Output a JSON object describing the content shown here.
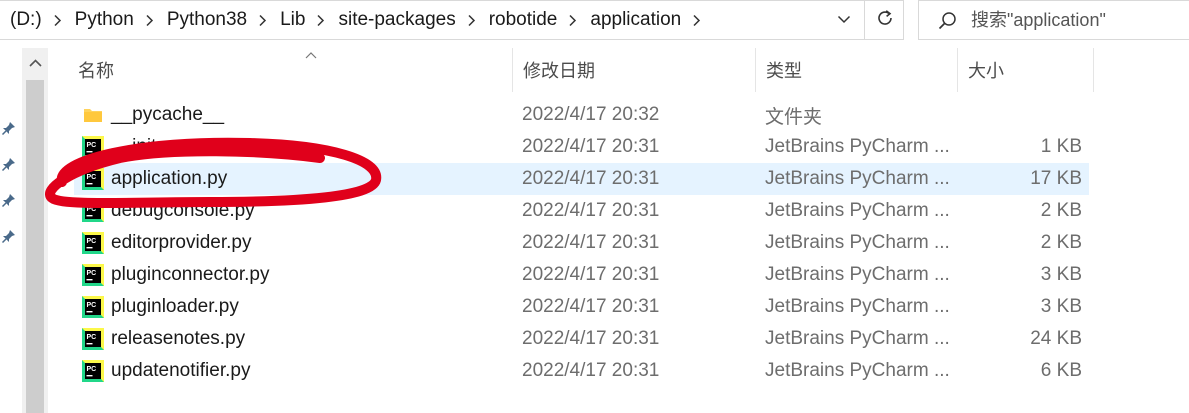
{
  "address_bar": {
    "crumbs": [
      "(D:)",
      "Python",
      "Python38",
      "Lib",
      "site-packages",
      "robotide",
      "application"
    ],
    "dropdown_icon": "chevron-down-icon",
    "refresh_icon": "refresh-icon"
  },
  "search": {
    "placeholder": "搜索\"application\"",
    "icon": "search-icon"
  },
  "columns": {
    "name": "名称",
    "date": "修改日期",
    "type": "类型",
    "size": "大小"
  },
  "files": [
    {
      "name": "__pycache__",
      "date": "2022/4/17 20:32",
      "type": "文件夹",
      "size": "",
      "icon": "folder-icon"
    },
    {
      "name": "__init__.py",
      "date": "2022/4/17 20:31",
      "type": "JetBrains PyCharm ...",
      "size": "1 KB",
      "icon": "pycharm-file-icon"
    },
    {
      "name": "application.py",
      "date": "2022/4/17 20:31",
      "type": "JetBrains PyCharm ...",
      "size": "17 KB",
      "icon": "pycharm-file-icon",
      "selected": true
    },
    {
      "name": "debugconsole.py",
      "date": "2022/4/17 20:31",
      "type": "JetBrains PyCharm ...",
      "size": "2 KB",
      "icon": "pycharm-file-icon"
    },
    {
      "name": "editorprovider.py",
      "date": "2022/4/17 20:31",
      "type": "JetBrains PyCharm ...",
      "size": "2 KB",
      "icon": "pycharm-file-icon"
    },
    {
      "name": "pluginconnector.py",
      "date": "2022/4/17 20:31",
      "type": "JetBrains PyCharm ...",
      "size": "3 KB",
      "icon": "pycharm-file-icon"
    },
    {
      "name": "pluginloader.py",
      "date": "2022/4/17 20:31",
      "type": "JetBrains PyCharm ...",
      "size": "3 KB",
      "icon": "pycharm-file-icon"
    },
    {
      "name": "releasenotes.py",
      "date": "2022/4/17 20:31",
      "type": "JetBrains PyCharm ...",
      "size": "24 KB",
      "icon": "pycharm-file-icon"
    },
    {
      "name": "updatenotifier.py",
      "date": "2022/4/17 20:31",
      "type": "JetBrains PyCharm ...",
      "size": "6 KB",
      "icon": "pycharm-file-icon"
    }
  ],
  "colors": {
    "selection": "#e5f3ff",
    "annotation_stroke": "#e0001b",
    "pycharm_green": "#21d789",
    "pycharm_yellow": "#fcf84a",
    "folder_yellow": "#ffd35c"
  }
}
